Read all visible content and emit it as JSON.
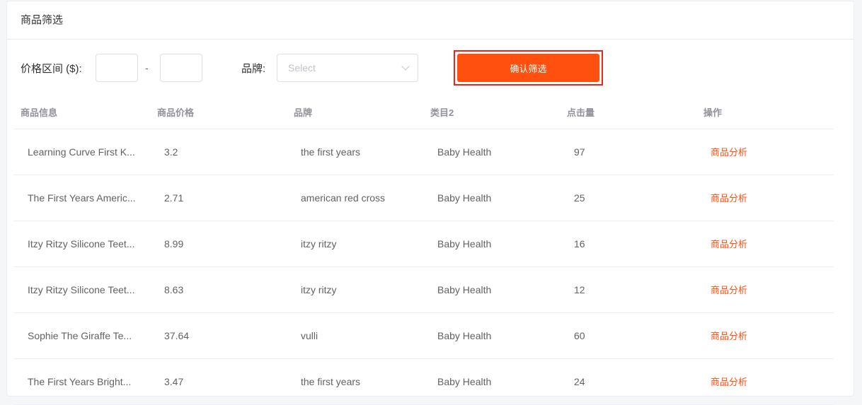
{
  "card": {
    "title": "商品筛选"
  },
  "filter": {
    "price_label": "价格区间 ($):",
    "price_min": "",
    "price_max": "",
    "dash": "-",
    "brand_label": "品牌:",
    "brand_placeholder": "Select",
    "confirm_label": "确认筛选"
  },
  "colors": {
    "accent": "#ff5010",
    "highlight_border": "#e8261c"
  },
  "table": {
    "columns": [
      "商品信息",
      "商品价格",
      "品牌",
      "类目2",
      "点击量",
      "操作"
    ],
    "rows": [
      {
        "name": "Learning Curve First K...",
        "price": "3.2",
        "brand": "the first years",
        "category": "Baby Health",
        "clicks": "97",
        "action": "商品分析"
      },
      {
        "name": "The First Years Americ...",
        "price": "2.71",
        "brand": "american red cross",
        "category": "Baby Health",
        "clicks": "25",
        "action": "商品分析"
      },
      {
        "name": "Itzy Ritzy Silicone Teet...",
        "price": "8.99",
        "brand": "itzy ritzy",
        "category": "Baby Health",
        "clicks": "16",
        "action": "商品分析"
      },
      {
        "name": "Itzy Ritzy Silicone Teet...",
        "price": "8.63",
        "brand": "itzy ritzy",
        "category": "Baby Health",
        "clicks": "12",
        "action": "商品分析"
      },
      {
        "name": "Sophie The Giraffe Te...",
        "price": "37.64",
        "brand": "vulli",
        "category": "Baby Health",
        "clicks": "60",
        "action": "商品分析"
      },
      {
        "name": "The First Years Bright...",
        "price": "3.47",
        "brand": "the first years",
        "category": "Baby Health",
        "clicks": "24",
        "action": "商品分析"
      }
    ]
  }
}
